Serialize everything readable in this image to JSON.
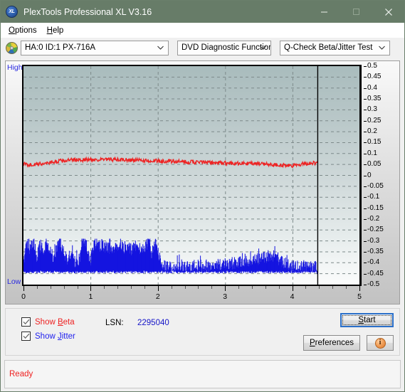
{
  "window": {
    "title": "PlexTools Professional XL V3.16",
    "app_icon": "xl-logo-icon",
    "minimize": "minimize-icon",
    "maximize": "maximize-icon",
    "close": "close-icon"
  },
  "menubar": {
    "items": [
      {
        "label": "Options",
        "accel": "O"
      },
      {
        "label": "Help",
        "accel": "H"
      }
    ]
  },
  "toolbar": {
    "drive_icon": "disc-icon",
    "drive": "HA:0 ID:1  PX-716A",
    "function": "DVD Diagnostic Functions",
    "test": "Q-Check Beta/Jitter Test"
  },
  "chart_labels": {
    "high": "High",
    "low": "Low"
  },
  "controls": {
    "show_beta": {
      "label": "Show Beta",
      "accel": "B",
      "checked": true,
      "color": "#ee2222"
    },
    "show_jitter": {
      "label": "Show Jitter",
      "accel": "J",
      "checked": true,
      "color": "#2222ee"
    },
    "lsn_label": "LSN:",
    "lsn_value": "2295040",
    "start": "Start",
    "start_accel": "S",
    "preferences": "Preferences",
    "preferences_accel": "P",
    "info_icon": "info-icon",
    "info_glyph": "i"
  },
  "status": {
    "text": "Ready",
    "color": "#ee2222"
  },
  "chart_data": {
    "type": "line",
    "title": "",
    "xlabel": "",
    "ylabel": "",
    "xlim": [
      0,
      5
    ],
    "ylim": [
      -0.5,
      0.5
    ],
    "grid": true,
    "y_ticks": [
      0.5,
      0.45,
      0.4,
      0.35,
      0.3,
      0.25,
      0.2,
      0.15,
      0.1,
      0.05,
      0,
      -0.05,
      -0.1,
      -0.15,
      -0.2,
      -0.25,
      -0.3,
      -0.35,
      -0.4,
      -0.45,
      -0.5
    ],
    "x_ticks": [
      0,
      1,
      2,
      3,
      4,
      5
    ],
    "x_minor_step": 0.2,
    "left_axis_label": "High",
    "left_axis_label_bottom": "Low",
    "marker_line_x": 4.37,
    "data_end_x": 4.37,
    "series": [
      {
        "name": "Show Beta",
        "color": "#ee2222",
        "type": "noisy-line",
        "band_center": [
          [
            0.0,
            0.052
          ],
          [
            0.1,
            0.048
          ],
          [
            0.2,
            0.05
          ],
          [
            0.3,
            0.055
          ],
          [
            0.45,
            0.062
          ],
          [
            0.6,
            0.068
          ],
          [
            0.8,
            0.071
          ],
          [
            1.0,
            0.072
          ],
          [
            1.3,
            0.072
          ],
          [
            1.6,
            0.07
          ],
          [
            1.9,
            0.067
          ],
          [
            2.2,
            0.064
          ],
          [
            2.5,
            0.061
          ],
          [
            2.8,
            0.058
          ],
          [
            3.1,
            0.056
          ],
          [
            3.4,
            0.054
          ],
          [
            3.6,
            0.052
          ],
          [
            3.8,
            0.048
          ],
          [
            3.95,
            0.043
          ],
          [
            4.05,
            0.046
          ],
          [
            4.2,
            0.055
          ],
          [
            4.37,
            0.058
          ]
        ],
        "noise_amplitude": 0.009
      },
      {
        "name": "Show Jitter",
        "color": "#1414e0",
        "type": "noise-band",
        "baseline": -0.448,
        "band_top": [
          [
            0.0,
            -0.395
          ],
          [
            0.05,
            -0.3
          ],
          [
            0.1,
            -0.34
          ],
          [
            0.15,
            -0.3
          ],
          [
            0.2,
            -0.375
          ],
          [
            0.25,
            -0.32
          ],
          [
            0.3,
            -0.36
          ],
          [
            0.35,
            -0.305
          ],
          [
            0.4,
            -0.35
          ],
          [
            0.45,
            -0.39
          ],
          [
            0.5,
            -0.33
          ],
          [
            0.55,
            -0.3
          ],
          [
            0.6,
            -0.355
          ],
          [
            0.65,
            -0.385
          ],
          [
            0.7,
            -0.35
          ],
          [
            0.75,
            -0.39
          ],
          [
            0.8,
            -0.4
          ],
          [
            0.85,
            -0.36
          ],
          [
            0.9,
            -0.3
          ],
          [
            0.95,
            -0.345
          ],
          [
            1.0,
            -0.39
          ],
          [
            1.05,
            -0.3
          ],
          [
            1.1,
            -0.33
          ],
          [
            1.15,
            -0.32
          ],
          [
            1.2,
            -0.325
          ],
          [
            1.25,
            -0.335
          ],
          [
            1.3,
            -0.33
          ],
          [
            1.4,
            -0.335
          ],
          [
            1.5,
            -0.33
          ],
          [
            1.6,
            -0.34
          ],
          [
            1.7,
            -0.335
          ],
          [
            1.8,
            -0.345
          ],
          [
            1.85,
            -0.3
          ],
          [
            1.9,
            -0.36
          ],
          [
            1.95,
            -0.31
          ],
          [
            2.0,
            -0.35
          ],
          [
            2.05,
            -0.395
          ],
          [
            2.1,
            -0.42
          ],
          [
            2.2,
            -0.418
          ],
          [
            2.4,
            -0.42
          ],
          [
            2.6,
            -0.415
          ],
          [
            2.8,
            -0.41
          ],
          [
            3.0,
            -0.405
          ],
          [
            3.2,
            -0.398
          ],
          [
            3.4,
            -0.388
          ],
          [
            3.55,
            -0.378
          ],
          [
            3.65,
            -0.368
          ],
          [
            3.75,
            -0.372
          ],
          [
            3.85,
            -0.395
          ],
          [
            3.95,
            -0.415
          ],
          [
            4.05,
            -0.42
          ],
          [
            4.15,
            -0.418
          ],
          [
            4.25,
            -0.42
          ],
          [
            4.37,
            -0.425
          ]
        ],
        "value_range": [
          -0.46,
          -0.3
        ]
      }
    ]
  }
}
